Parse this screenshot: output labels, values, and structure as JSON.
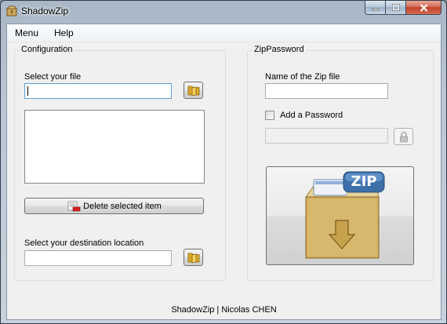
{
  "window": {
    "title": "ShadowZip"
  },
  "menu": {
    "items": [
      "Menu",
      "Help"
    ]
  },
  "configuration": {
    "group_title": "Configuration",
    "select_file_label": "Select your file",
    "select_file_value": "",
    "delete_button_label": "Delete selected item",
    "destination_label": "Select your destination location",
    "destination_value": ""
  },
  "zip_password": {
    "group_title": "ZipPassword",
    "zip_name_label": "Name of the Zip file",
    "zip_name_value": "",
    "add_password_label": "Add a Password",
    "add_password_checked": false,
    "password_value": "",
    "zip_badge_text": "ZIP"
  },
  "footer": {
    "text": "ShadowZip | Nicolas CHEN"
  },
  "icons": {
    "app": "zip-box-icon",
    "browse": "folder-icon",
    "delete": "delete-list-icon",
    "lock": "lock-icon",
    "zip_archive": "zip-archive-icon"
  }
}
